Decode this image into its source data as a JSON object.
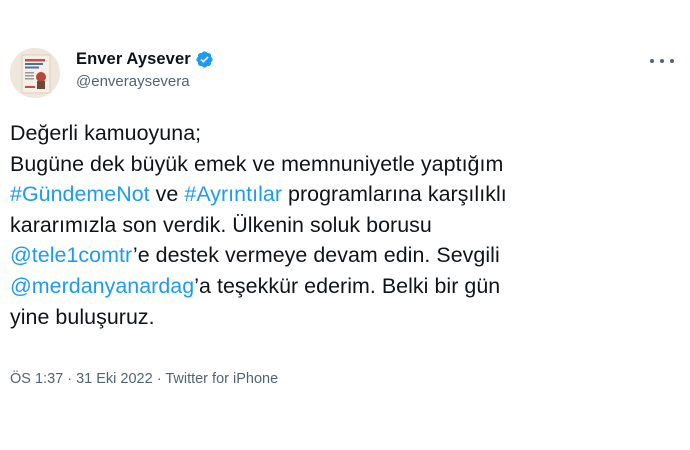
{
  "author": {
    "display_name": "Enver Aysever",
    "handle": "@enveraysevera",
    "verified_icon": "verified-badge-icon",
    "avatar_icon": "book-cover-avatar"
  },
  "more_icon": "ellipsis-icon",
  "tweet": {
    "line1": "Değerli kamuoyuna;",
    "line2": "Bugüne dek büyük emek ve memnuniyetle yaptığım",
    "hashtag1": "#GündemeNot",
    "line3_mid": " ve ",
    "hashtag2": "#Ayrıntılar",
    "line3_end": " programlarına karşılıklı",
    "line4": "kararımızla son verdik. Ülkenin soluk borusu",
    "mention1": "@tele1comtr",
    "line5_end": "’e destek vermeye devam edin. Sevgili",
    "mention2": "@merdanyanardag",
    "line6_end": "’a teşekkür ederim. Belki bir gün",
    "line7": "yine buluşuruz."
  },
  "meta": {
    "time": "ÖS 1:37",
    "sep1": " · ",
    "date": "31 Eki 2022",
    "sep2": " · ",
    "source": "Twitter for iPhone"
  },
  "colors": {
    "link": "#1d9bf0",
    "text": "#0f1419",
    "secondary": "#536471"
  }
}
